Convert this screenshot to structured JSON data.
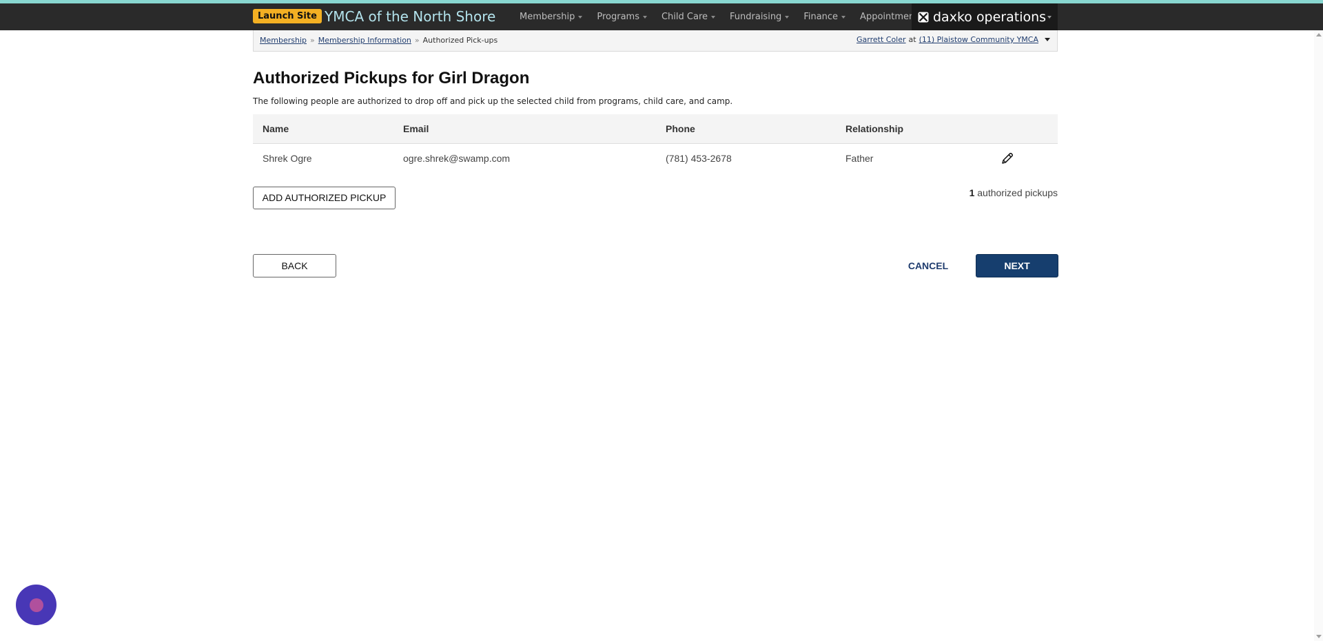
{
  "topbar": {
    "launch_label": "Launch Site",
    "org_name": "YMCA of the North Shore",
    "nav": [
      "Membership",
      "Programs",
      "Child Care",
      "Fundraising",
      "Finance",
      "Appointments"
    ],
    "brand": "daxko operations"
  },
  "breadcrumb": {
    "items": [
      "Membership",
      "Membership Information",
      "Authorized Pick-ups"
    ],
    "user": "Garrett Coler",
    "at": "at",
    "location": "(11) Plaistow Community YMCA"
  },
  "page": {
    "title": "Authorized Pickups for Girl Dragon",
    "description": "The following people are authorized to drop off and pick up the selected child from programs, child care, and camp."
  },
  "table": {
    "columns": [
      "Name",
      "Email",
      "Phone",
      "Relationship"
    ],
    "rows": [
      {
        "name": "Shrek Ogre",
        "email": "ogre.shrek@swamp.com",
        "phone": "(781) 453-2678",
        "relationship": "Father"
      }
    ]
  },
  "actions": {
    "add_label": "ADD AUTHORIZED PICKUP",
    "count_number": "1",
    "count_text": " authorized pickups",
    "back_label": "BACK",
    "cancel_label": "CANCEL",
    "next_label": "NEXT"
  },
  "icons": {
    "edit": "pencil-icon",
    "chat": "chat-icon",
    "brand_logo": "envelope-x-icon"
  },
  "colors": {
    "accent_primary": "#163e6e",
    "launch_badge": "#f3b023",
    "topbar": "#2a2a2a",
    "org_name": "#b3e3ec",
    "chat": "#4837b6"
  }
}
